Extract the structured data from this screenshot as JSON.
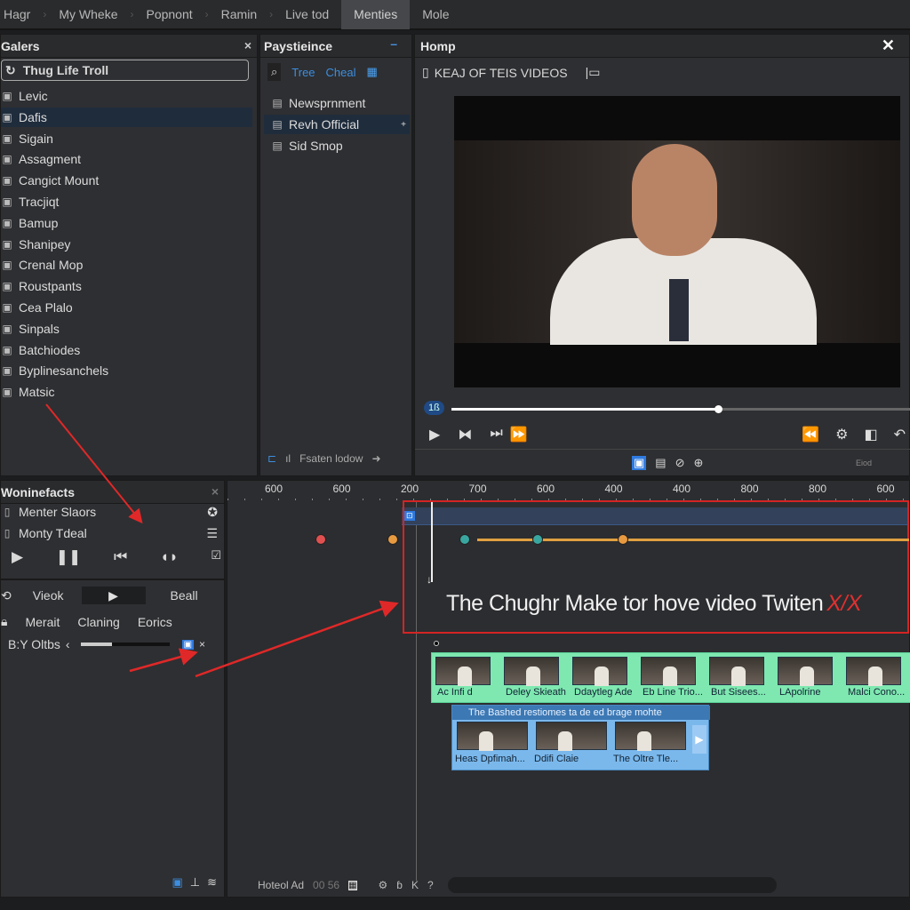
{
  "topbar": {
    "tabs": [
      "Hagr",
      "My Wheke",
      "Popnont",
      "Ramin",
      "Live tod",
      "Menties",
      "Mole"
    ],
    "active": 5
  },
  "galleries": {
    "title": "Galers",
    "search_value": "Thug Life Troll",
    "items": [
      "Levic",
      "Dafis",
      "Sigain",
      "Assagment",
      "Cangict Mount",
      "Tracjiqt",
      "Bamup",
      "Shanipey",
      "Crenal Mop",
      "Roustpants",
      "Cea Plalo",
      "Sinpals",
      "Batchiodes",
      "Byplinesanchels",
      "Matsic"
    ],
    "selected": 1
  },
  "playlist": {
    "title": "Paystieince",
    "filter1": "Tree",
    "filter2": "Cheal",
    "items": [
      "Newsprnment",
      "Revh Official",
      "Sid Smop"
    ],
    "selected": 1,
    "footer": "Fsaten lodow"
  },
  "viewer": {
    "title": "Homp",
    "subtitle": "KEAJ OF TEIS VIDEOS",
    "time_badge": "1ß",
    "progress_percent": 58,
    "status_label": "Eiod"
  },
  "effects": {
    "title": "Woninefacts",
    "rows": [
      "Menter Slaors",
      "Monty Tdeal"
    ],
    "labels": {
      "view": "Vieok",
      "beall": "Beall",
      "merait": "Merait",
      "claning": "Claning",
      "eorics": "Eorics",
      "opts": "B:Y Oltbs"
    },
    "slider_percent": 35
  },
  "timeline": {
    "ruler": [
      "600",
      "600",
      "200",
      "700",
      "600",
      "400",
      "400",
      "800",
      "800",
      "600"
    ],
    "caption": "The Chughr Make tor hove video Twiten",
    "caption_tail": "X/X",
    "keyframe_colors": [
      "#e05050",
      "#e89a40",
      "#3aa6a0",
      "#3aa6a0",
      "#e89a40"
    ],
    "clips": [
      "Ac Infi d",
      "Deley Skieath",
      "Ddaytleg Ade",
      "Eb Line Trio...",
      "But Sisees...",
      "LApolrine",
      "Malci Cono..."
    ],
    "popup": {
      "title": "The Bashed restiomes ta de ed brage mohte",
      "clips": [
        "Heas Dpfimah...",
        "Ddifi Claie",
        "The Oltre Tle..."
      ]
    },
    "footer": {
      "label": "Hoteol Ad",
      "time": "00 56"
    }
  },
  "colors": {
    "accent": "#2f7ae0",
    "annotation": "#e02828",
    "clip_green": "#7ee8b0",
    "popup_blue": "#7ab8ec"
  }
}
